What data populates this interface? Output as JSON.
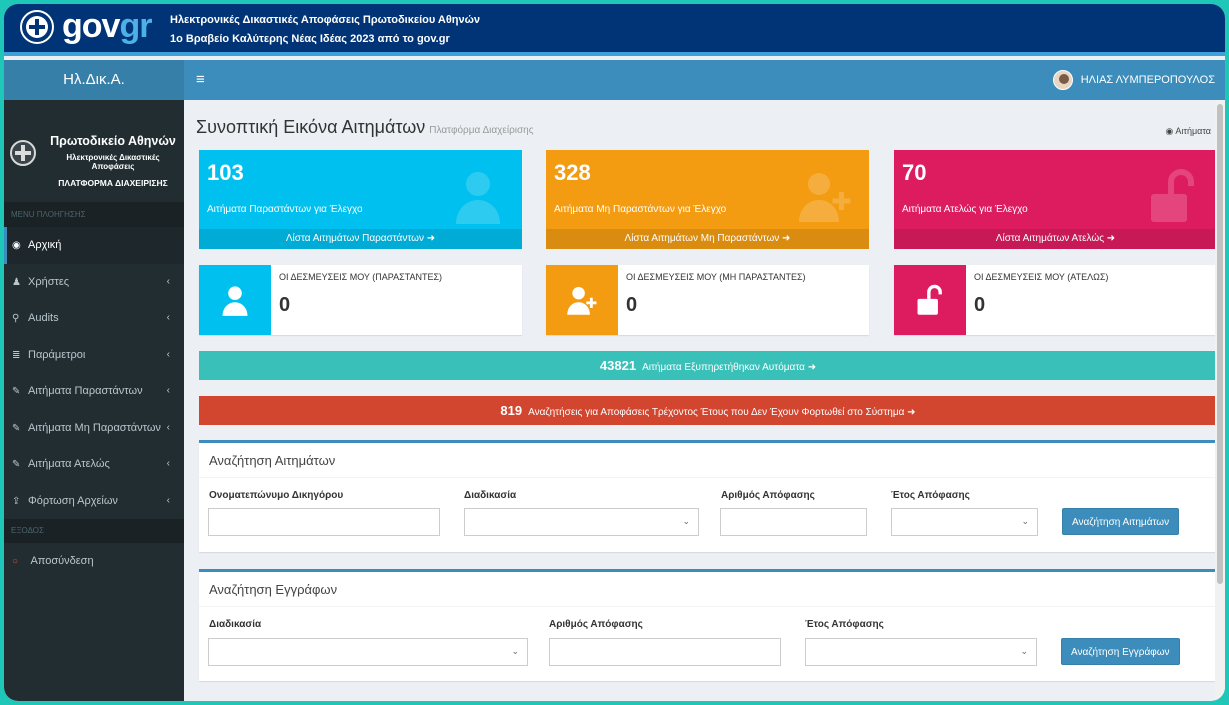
{
  "govbar": {
    "logo_left": "gov",
    "logo_right": "gr",
    "title": "Ηλεκτρονικές Δικαστικές Αποφάσεις Πρωτοδικείου Αθηνών",
    "subtitle": "1ο Βραβείο Καλύτερης Νέας Ιδέας 2023 από το gov.gr",
    "color": "#003476"
  },
  "topnav": {
    "brand": "Ηλ.Δικ.Α.",
    "toggle": "≡",
    "user": "ΗΛΙΑΣ ΛΥΜΠΕΡΟΠΟΥΛΟΣ",
    "color": "#3c8dbc"
  },
  "sidebar": {
    "court": "Πρωτοδικείο Αθηνών",
    "subtitle": "Ηλεκτρονικές Δικαστικές Αποφάσεις",
    "platform": "ΠΛΑΤΦΟΡΜΑ ΔΙΑΧΕΙΡΙΣΗΣ",
    "menu_header": "MENU ΠΛΟΗΓΗΣΗΣ",
    "exit_header": "ΕΞΟΔΟΣ",
    "items": [
      {
        "label": "Αρχική",
        "icon": "dashboard-icon",
        "glyph": "◉"
      },
      {
        "label": "Χρήστες",
        "icon": "user-icon",
        "glyph": "♟"
      },
      {
        "label": "Audits",
        "icon": "search-icon",
        "glyph": "⚲"
      },
      {
        "label": "Παράμετροι",
        "icon": "list-icon",
        "glyph": "≣"
      },
      {
        "label": "Αιτήματα Παραστάντων",
        "icon": "edit-icon",
        "glyph": "✎"
      },
      {
        "label": "Αιτήματα Μη Παραστάντων",
        "icon": "edit-icon",
        "glyph": "✎"
      },
      {
        "label": "Αιτήματα Ατελώς",
        "icon": "edit-icon",
        "glyph": "✎"
      },
      {
        "label": "Φόρτωση Αρχείων",
        "icon": "upload-icon",
        "glyph": "⇪"
      }
    ],
    "chevron": "‹",
    "logout": {
      "label": "Αποσύνδεση",
      "icon": "circle-icon",
      "glyph": "○"
    }
  },
  "page": {
    "title": "Συνοπτική Εικόνα Αιτημάτων",
    "subtitle": "Πλατφόρμα Διαχείρισης",
    "breadcrumb": "Αιτήματα",
    "breadcrumb_glyph": "◉"
  },
  "stats": [
    {
      "value": "103",
      "label": "Αιτήματα Παραστάντων για Έλεγχο",
      "link": "Λίστα Αιτημάτων Παραστάντων ➜",
      "color": "#00c0ef",
      "icon": "user-icon"
    },
    {
      "value": "328",
      "label": "Αιτήματα Μη Παραστάντων για Έλεγχο",
      "link": "Λίστα Αιτημάτων Μη Παραστάντων ➜",
      "color": "#f39c12",
      "icon": "user-plus-icon"
    },
    {
      "value": "70",
      "label": "Αιτήματα Ατελώς για Έλεγχο",
      "link": "Λίστα Αιτημάτων Ατελώς ➜",
      "color": "#dd1c5f",
      "icon": "unlock-icon"
    }
  ],
  "commitments": [
    {
      "label": "ΟΙ ΔΕΣΜΕΥΣΕΙΣ ΜΟΥ (ΠΑΡΑΣΤΑΝΤΕΣ)",
      "value": "0",
      "color": "#00c0ef",
      "icon": "user-icon"
    },
    {
      "label": "ΟΙ ΔΕΣΜΕΥΣΕΙΣ ΜΟΥ (ΜΗ ΠΑΡΑΣΤΑΝΤΕΣ)",
      "value": "0",
      "color": "#f39c12",
      "icon": "user-plus-icon"
    },
    {
      "label": "ΟΙ ΔΕΣΜΕΥΣΕΙΣ ΜΟΥ (ΑΤΕΛΩΣ)",
      "value": "0",
      "color": "#dd1c5f",
      "icon": "unlock-icon"
    }
  ],
  "auto_bar": {
    "count": "43821",
    "text": "Αιτήματα Εξυπηρετήθηκαν Αυτόματα ➜",
    "color": "#39c0b8"
  },
  "missing_bar": {
    "count": "819",
    "text": "Αναζητήσεις για Αποφάσεις Τρέχοντος Έτους που Δεν Έχουν Φορτωθεί στο Σύστημα ➜",
    "color": "#d2452f"
  },
  "search_requests": {
    "title": "Αναζήτηση Αιτημάτων",
    "lawyer_label": "Ονοματεπώνυμο Δικηγόρου",
    "lawyer_value": "",
    "procedure_label": "Διαδικασία",
    "procedure_value": "",
    "decision_label": "Αριθμός Απόφασης",
    "decision_value": "",
    "year_label": "Έτος Απόφασης",
    "year_value": "",
    "button": "Αναζήτηση Αιτημάτων"
  },
  "search_documents": {
    "title": "Αναζήτηση Εγγράφων",
    "procedure_label": "Διαδικασία",
    "procedure_value": "",
    "decision_label": "Αριθμός Απόφασης",
    "decision_value": "",
    "year_label": "Έτος Απόφασης",
    "year_value": "",
    "button": "Αναζήτηση Εγγράφων"
  },
  "caret": "⌄"
}
